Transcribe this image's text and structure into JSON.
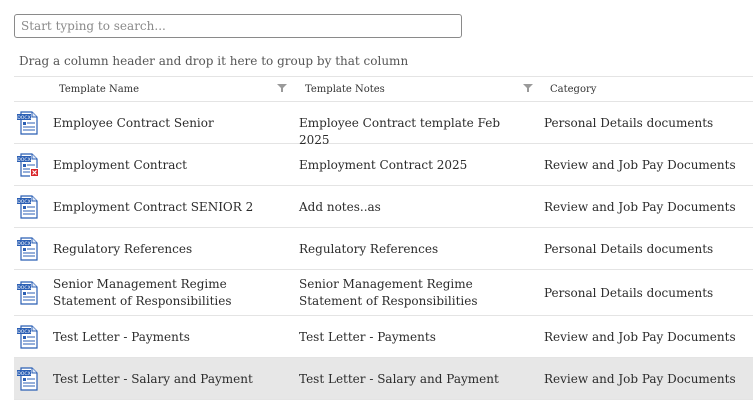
{
  "search": {
    "placeholder": "Start typing to search..."
  },
  "group_hint": "Drag a column header and drop it here to group by that column",
  "columns": {
    "template_name": "Template Name",
    "template_notes": "Template Notes",
    "category": "Category"
  },
  "rows": [
    {
      "name": "Employee Contract Senior",
      "notes": "Employee Contract template Feb 2025",
      "category": "Personal Details documents",
      "icon": "docx-file-icon"
    },
    {
      "name": "Employment Contract",
      "notes": "Employment Contract 2025",
      "category": "Review and Job Pay Documents",
      "icon": "docx-file-error-icon"
    },
    {
      "name": "Employment Contract SENIOR 2",
      "notes": "Add notes..as",
      "category": "Review and Job Pay Documents",
      "icon": "docx-file-icon"
    },
    {
      "name": "Regulatory References",
      "notes": "Regulatory References",
      "category": "Personal Details documents",
      "icon": "docx-file-icon"
    },
    {
      "name": "Senior Management Regime Statement of Responsibilities",
      "notes": "Senior Management Regime Statement of Responsibilities",
      "category": "Personal Details documents",
      "icon": "docx-file-icon"
    },
    {
      "name": "Test Letter - Payments",
      "notes": "Test Letter - Payments",
      "category": "Review and Job Pay Documents",
      "icon": "docx-file-icon"
    },
    {
      "name": "Test Letter - Salary and Payment",
      "notes": "Test Letter - Salary and Payment",
      "category": "Review and Job Pay Documents",
      "icon": "docx-file-icon",
      "selected": true
    }
  ],
  "colors": {
    "icon_blue": "#2b5fb4",
    "error_red": "#d9252a",
    "selected_row": "#e7e7e7"
  }
}
